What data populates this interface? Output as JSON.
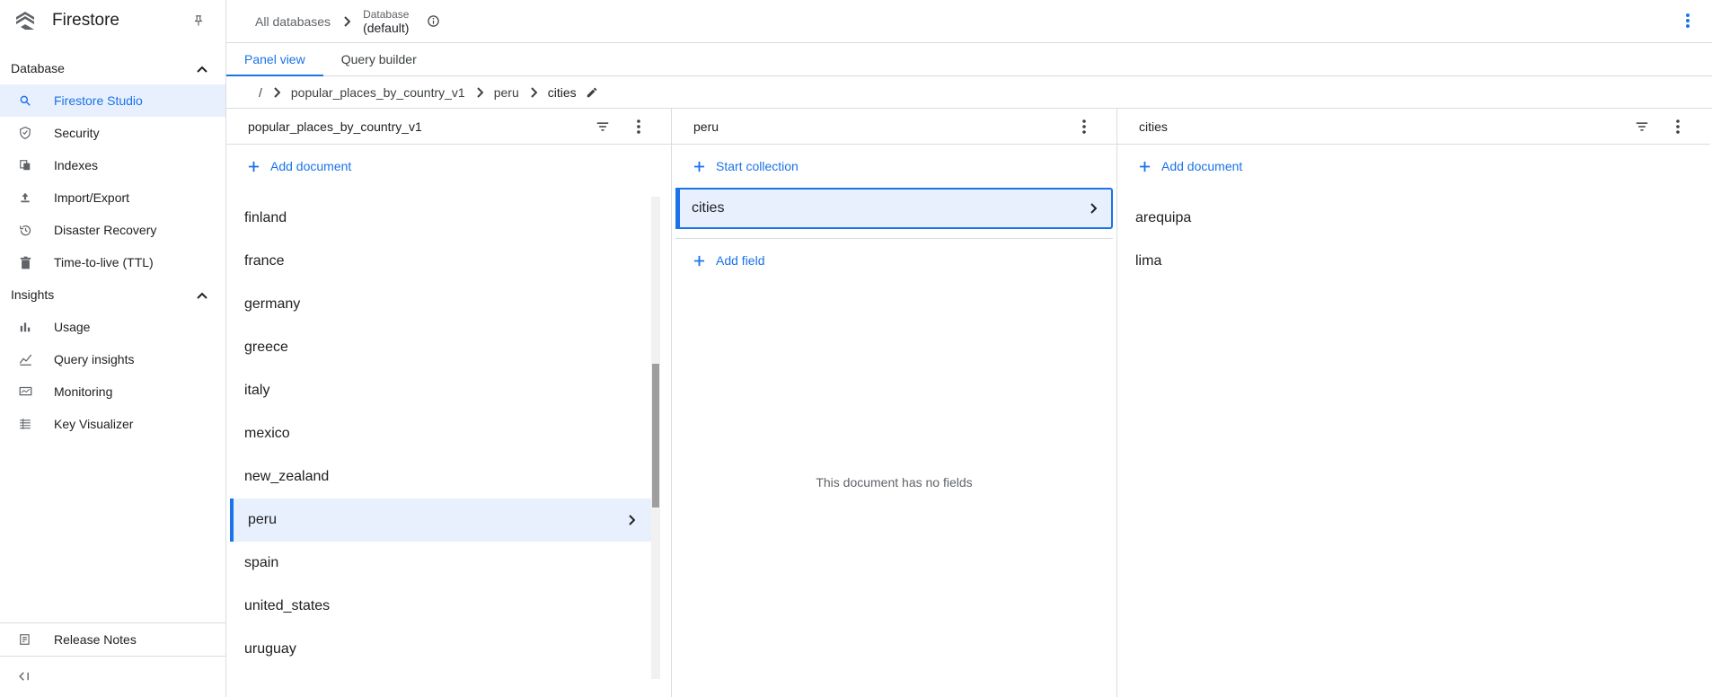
{
  "app": {
    "title": "Firestore"
  },
  "sidebar": {
    "section_database": "Database",
    "database_items": [
      {
        "label": "Firestore Studio",
        "icon": "search-icon",
        "active": true
      },
      {
        "label": "Security",
        "icon": "shield-icon"
      },
      {
        "label": "Indexes",
        "icon": "indexes-icon"
      },
      {
        "label": "Import/Export",
        "icon": "upload-icon"
      },
      {
        "label": "Disaster Recovery",
        "icon": "history-icon"
      },
      {
        "label": "Time-to-live (TTL)",
        "icon": "trash-icon"
      }
    ],
    "section_insights": "Insights",
    "insights_items": [
      {
        "label": "Usage",
        "icon": "bar-chart-icon"
      },
      {
        "label": "Query insights",
        "icon": "line-chart-icon"
      },
      {
        "label": "Monitoring",
        "icon": "monitor-icon"
      },
      {
        "label": "Key Visualizer",
        "icon": "grid-icon"
      }
    ],
    "release_notes": "Release Notes"
  },
  "topbar": {
    "all_databases": "All databases",
    "database_label": "Database",
    "database_name": "(default)"
  },
  "tabs": [
    {
      "label": "Panel view",
      "active": true
    },
    {
      "label": "Query builder"
    }
  ],
  "path": {
    "root": "/",
    "segments": [
      "popular_places_by_country_v1",
      "peru",
      "cities"
    ]
  },
  "panel1": {
    "title": "popular_places_by_country_v1",
    "add_label": "Add document",
    "documents": [
      "finland",
      "france",
      "germany",
      "greece",
      "italy",
      "mexico",
      "new_zealand",
      "peru",
      "spain",
      "united_states",
      "uruguay"
    ],
    "selected": "peru"
  },
  "panel2": {
    "title": "peru",
    "start_collection": "Start collection",
    "collection": "cities",
    "add_field": "Add field",
    "empty": "This document has no fields"
  },
  "panel3": {
    "title": "cities",
    "add_label": "Add document",
    "documents": [
      "arequipa",
      "lima"
    ]
  },
  "colors": {
    "accent": "#1a73e8",
    "selected_bg": "#e8f0fe",
    "border": "#dadce0"
  }
}
